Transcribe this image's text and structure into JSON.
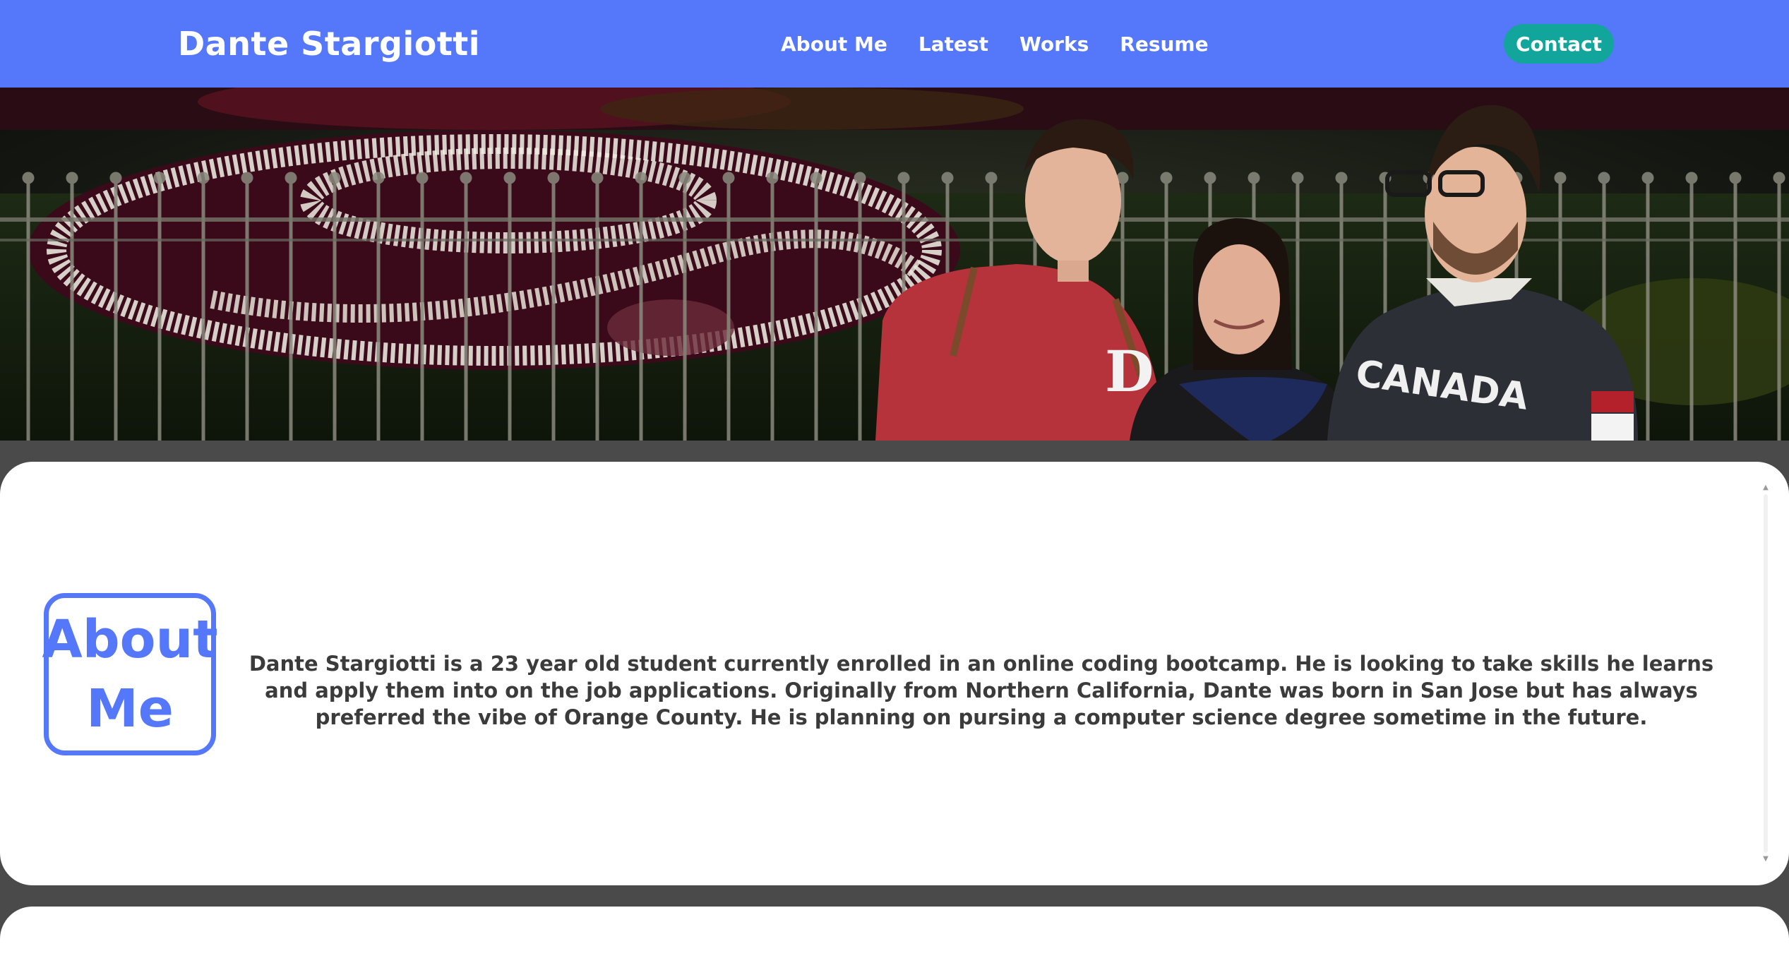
{
  "header": {
    "brand": "Dante Stargiotti",
    "nav": [
      {
        "label": "About Me"
      },
      {
        "label": "Latest"
      },
      {
        "label": "Works"
      },
      {
        "label": "Resume"
      }
    ],
    "contact_label": "Contact"
  },
  "hero": {
    "alt": "Photo of Dante Stargiotti with family in front of a flower display"
  },
  "about": {
    "heading_line1": "About",
    "heading_line2": "Me",
    "body": "Dante Stargiotti is a 23 year old student currently enrolled in an online coding bootcamp. He is looking to take skills he learns and apply them into on the job applications. Originally from Northern California, Dante was born in San Jose but has always preferred the vibe of Orange County. He is planning on pursing a computer science degree sometime in the future."
  },
  "colors": {
    "header_bg": "#5577fa",
    "contact_bg": "#11a59b",
    "page_bg": "#4a4a4a",
    "accent": "#5577fa",
    "body_text": "#3b3b3b"
  }
}
